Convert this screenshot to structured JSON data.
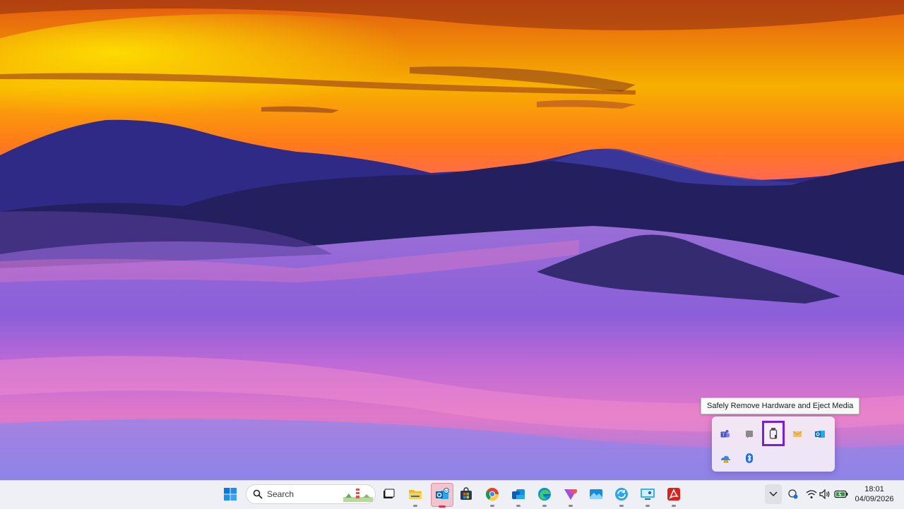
{
  "desktop": {
    "wallpaper": "sunset-mountains-fog"
  },
  "tooltip": {
    "text": "Safely Remove Hardware and Eject Media"
  },
  "tray_flyout": {
    "icons": [
      "teams-icon",
      "chat-bubble-icon",
      "usb-eject-icon",
      "mail-icon",
      "outlook-icon",
      "onedrive-warning-icon",
      "bluetooth-icon"
    ],
    "highlighted": "usb-eject-icon",
    "highlight_color": "#7a1fd6"
  },
  "taskbar": {
    "search_label": "Search",
    "apps": [
      "start-icon",
      "task-view-icon",
      "file-explorer-icon",
      "outlook-icon",
      "store-icon",
      "chrome-icon",
      "outlook-new-icon",
      "edge-icon",
      "power-automate-icon",
      "photos-icon",
      "sync-icon",
      "remote-desktop-icon",
      "acrobat-icon"
    ],
    "tray_icons": [
      "chevron-up-icon",
      "network-status-icon",
      "wifi-icon",
      "volume-icon",
      "battery-icon"
    ]
  },
  "clock": {
    "time": "18:01",
    "date": "04/09/2026"
  }
}
